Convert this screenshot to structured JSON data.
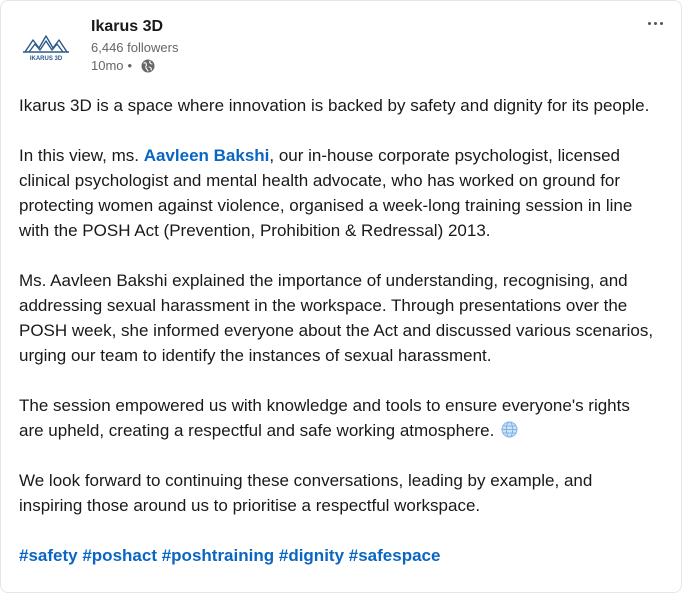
{
  "post": {
    "author": {
      "name": "Ikarus 3D",
      "followers": "6,446 followers",
      "time": "10mo",
      "separator": "•",
      "visibility_icon": "globe-icon",
      "logo_text": "IKARUS 3D"
    },
    "menu_icon": "ellipsis-icon",
    "paragraphs": {
      "p1": "Ikarus 3D is a space where innovation is backed by safety and dignity for its people.",
      "p2_before": "In this view, ms. ",
      "p2_mention": "Aavleen Bakshi",
      "p2_after": ", our in-house corporate psychologist, licensed clinical psychologist and mental health advocate, who has worked on ground for protecting women against violence, organised a week-long training session in line with the POSH Act (Prevention, Prohibition & Redressal) 2013.",
      "p3": "Ms. Aavleen Bakshi explained the importance of understanding, recognising, and addressing sexual harassment in the workspace. Through presentations over the POSH week, she informed everyone about the Act and discussed various scenarios, urging our team to identify the instances of sexual harassment.",
      "p4": "The session empowered us with knowledge and tools to ensure everyone's rights are upheld, creating a respectful and safe working atmosphere.",
      "p4_emoji": "globe-emoji-icon",
      "p5": "We look forward to continuing these conversations, leading by example, and inspiring those around us to prioritise a respectful workspace."
    },
    "hashtags": [
      "#safety",
      "#poshact",
      "#poshtraining",
      "#dignity",
      "#safespace"
    ]
  },
  "colors": {
    "link": "#0a66c2",
    "text": "#191919",
    "muted": "#666666",
    "logo": "#2a5a8a"
  }
}
